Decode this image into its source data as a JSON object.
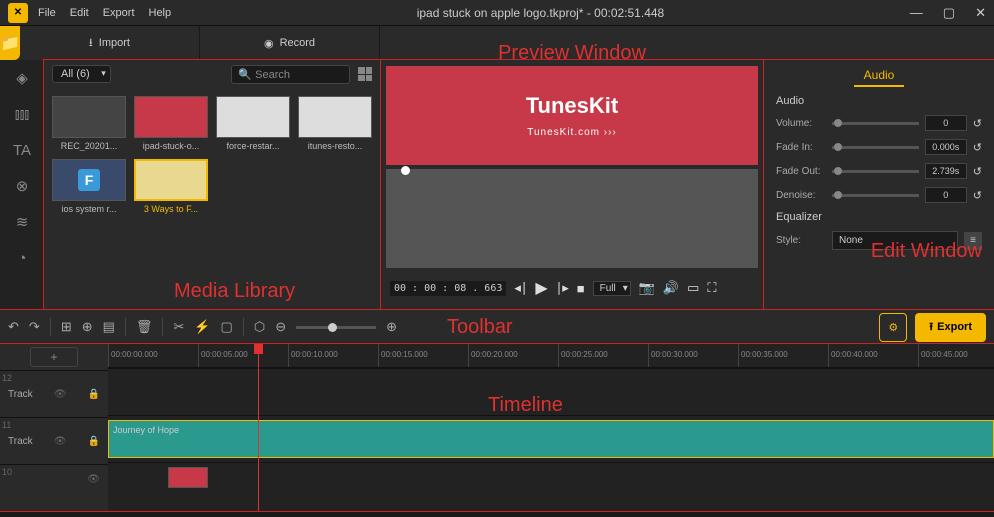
{
  "titlebar": {
    "menu": [
      "File",
      "Edit",
      "Export",
      "Help"
    ],
    "title": "ipad stuck on apple logo.tkproj* - 00:02:51.448"
  },
  "top_actions": {
    "import": "Import",
    "record": "Record"
  },
  "media": {
    "filter": "All (6)",
    "search_placeholder": "Search",
    "items": [
      {
        "label": "REC_20201...",
        "thumb": "dark"
      },
      {
        "label": "ipad-stuck-o...",
        "thumb": "tk"
      },
      {
        "label": "force-restar...",
        "thumb": "white"
      },
      {
        "label": "itunes-resto...",
        "thumb": "white"
      },
      {
        "label": "ios system r...",
        "thumb": "sys"
      },
      {
        "label": "3 Ways to F...",
        "thumb": "yellow",
        "selected": true
      }
    ]
  },
  "preview": {
    "brand": "TunesKit",
    "site": "TunesKit.com   ›››",
    "timecode": "00 : 00 : 08 . 663",
    "quality": "Full"
  },
  "edit": {
    "tab": "Audio",
    "section": "Audio",
    "volume": {
      "label": "Volume:",
      "value": "0"
    },
    "fade_in": {
      "label": "Fade In:",
      "value": "0.000s"
    },
    "fade_out": {
      "label": "Fade Out:",
      "value": "2.739s"
    },
    "denoise": {
      "label": "Denoise:",
      "value": "0"
    },
    "equalizer": "Equalizer",
    "style_label": "Style:",
    "style_value": "None"
  },
  "toolbar": {
    "export": "Export"
  },
  "timeline": {
    "ruler": [
      "00:00:00.000",
      "00:00:05.000",
      "00:00:10.000",
      "00:00:15.000",
      "00:00:20.000",
      "00:00:25.000",
      "00:00:30.000",
      "00:00:35.000",
      "00:00:40.000",
      "00:00:45.000"
    ],
    "tracks": [
      {
        "num": "12",
        "label": "Track"
      },
      {
        "num": "11",
        "label": "Track",
        "clip": "Journey of Hope"
      },
      {
        "num": "10",
        "label": ""
      }
    ]
  },
  "annotations": {
    "media": "Media Library",
    "preview": "Preview Window",
    "edit": "Edit Window",
    "toolbar": "Toolbar",
    "timeline": "Timeline"
  }
}
